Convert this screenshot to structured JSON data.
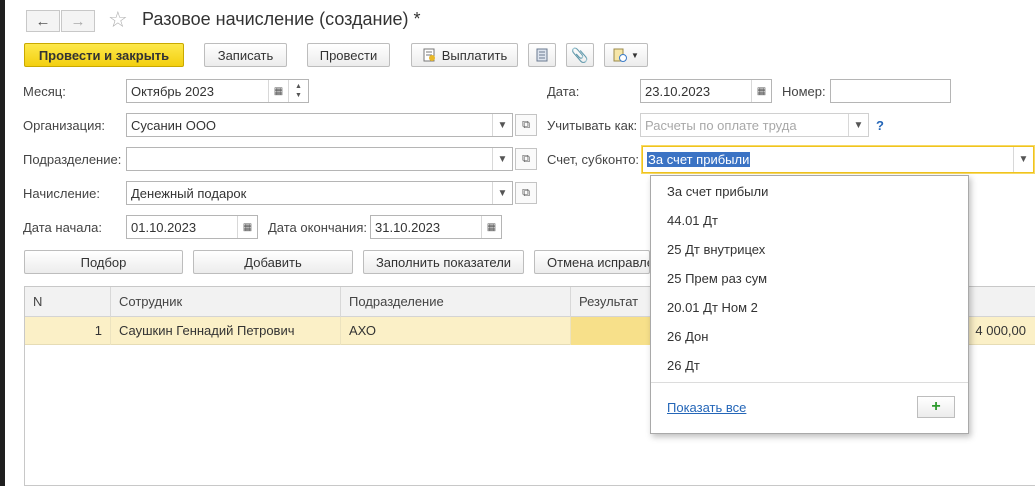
{
  "header": {
    "title": "Разовое начисление (создание) *"
  },
  "toolbar": {
    "post_and_close": "Провести и закрыть",
    "save": "Записать",
    "post": "Провести",
    "pay": "Выплатить"
  },
  "form": {
    "month_label": "Месяц:",
    "month_value": "Октябрь 2023",
    "organization_label": "Организация:",
    "organization_value": "Сусанин ООО",
    "department_label": "Подразделение:",
    "department_value": "",
    "accrual_label": "Начисление:",
    "accrual_value": "Денежный подарок",
    "start_date_label": "Дата начала:",
    "start_date_value": "01.10.2023",
    "end_date_label": "Дата окончания:",
    "end_date_value": "31.10.2023",
    "date_label": "Дата:",
    "date_value": "23.10.2023",
    "number_label": "Номер:",
    "number_value": "",
    "account_as_label": "Учитывать как:",
    "account_as_placeholder": "Расчеты по оплате труда",
    "help": "?",
    "account_subconto_label": "Счет, субконто:",
    "account_subconto_value": "За счет прибыли"
  },
  "table_buttons": {
    "pick": "Подбор",
    "add": "Добавить",
    "fill_indicators": "Заполнить показатели",
    "cancel_corrections": "Отмена исправле"
  },
  "table": {
    "columns": [
      "N",
      "Сотрудник",
      "Подразделение",
      "Результат"
    ],
    "rows": [
      {
        "n": "1",
        "employee": "Саушкин Геннадий Петрович",
        "department": "АХО",
        "result": "",
        "amount": "4 000,00"
      }
    ]
  },
  "dropdown": {
    "items": [
      "За счет прибыли",
      "44.01 Дт",
      "25 Дт внутрицех",
      "25 Прем раз сум",
      "20.01 Дт Ном 2",
      "26 Дон",
      "26 Дт"
    ],
    "show_all": "Показать все",
    "add_icon": "plus-icon"
  },
  "colors": {
    "primary_button": "#f3cf10",
    "selected_row": "#fbf0c7",
    "focus_border": "#f0c31e",
    "link": "#2466b8"
  }
}
